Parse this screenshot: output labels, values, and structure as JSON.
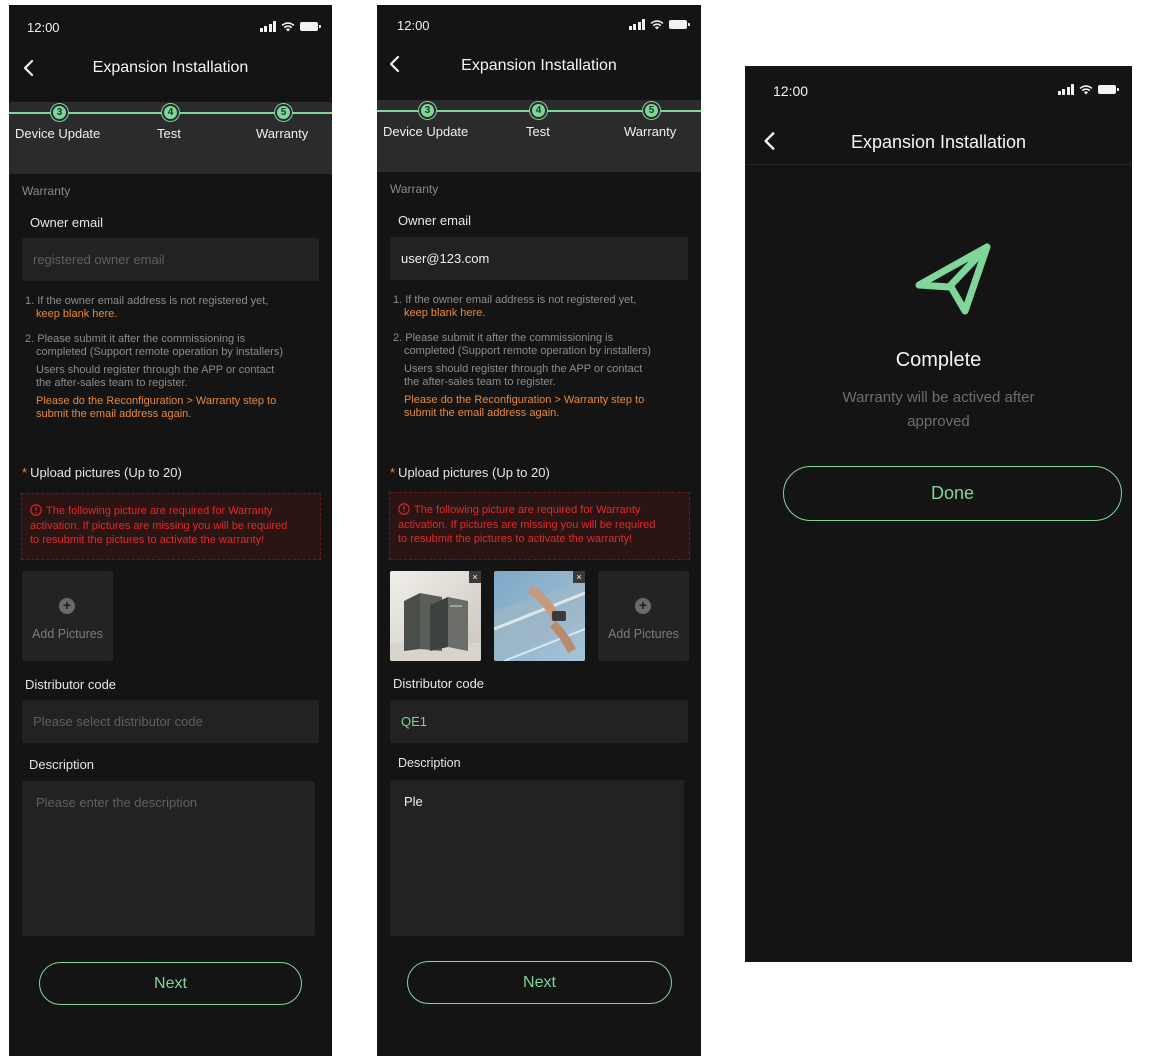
{
  "status_bar": {
    "time": "12:00"
  },
  "header": {
    "title": "Expansion Installation"
  },
  "stepper": {
    "steps": [
      {
        "number": "3",
        "label": "Device Update"
      },
      {
        "number": "4",
        "label": "Test"
      },
      {
        "number": "5",
        "label": "Warranty"
      }
    ]
  },
  "form": {
    "section_title": "Warranty",
    "owner_email_label": "Owner email",
    "owner_email_placeholder": "registered owner email",
    "notes": {
      "n1a": "1. If the owner email address is not registered yet,",
      "n1b": "keep blank here.",
      "n2a": "2. Please submit it after the commissioning is",
      "n2b": "completed (Support remote operation by installers)",
      "n2c": "Users should register through the APP or contact",
      "n2d": "the after-sales team to register.",
      "n2e": "Please do the Reconfiguration > Warranty step to",
      "n2f": "submit the email address again."
    },
    "upload_required_mark": "*",
    "upload_label": "Upload pictures (Up to 20)",
    "warning": {
      "l1": "The following picture are required for Warranty",
      "l2": "activation. If pictures are missing you will be required",
      "l3": "to resubmit the pictures to activate the warranty!"
    },
    "add_pictures_label": "Add Pictures",
    "plus_glyph": "+",
    "close_glyph": "×",
    "distributor_label": "Distributor code",
    "distributor_placeholder": "Please select distributor code",
    "description_label": "Description",
    "description_placeholder": "Please enter the description",
    "next_label": "Next"
  },
  "filled_form": {
    "owner_email_value": "user@123.com",
    "distributor_value": "QE1",
    "description_value": "Ple"
  },
  "complete": {
    "title": "Complete",
    "message_l1": "Warranty will be actived after",
    "message_l2": "approved",
    "done_label": "Done"
  },
  "colors": {
    "accent_green": "#7fd59a",
    "warning_orange": "#e8883a",
    "error_red": "#e02a2a",
    "background": "#141414",
    "field": "#222222"
  },
  "icons": [
    "back-chevron-icon",
    "signal-icon",
    "wifi-icon",
    "battery-icon",
    "info-icon",
    "plus-icon",
    "close-icon",
    "paper-plane-icon"
  ]
}
